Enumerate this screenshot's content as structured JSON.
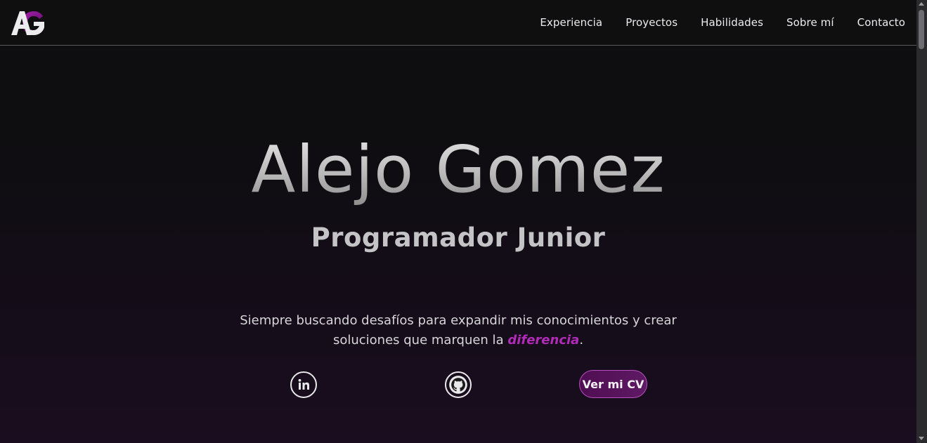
{
  "header": {
    "logo_icon": "ag-monogram-logo",
    "nav": [
      {
        "label": "Experiencia"
      },
      {
        "label": "Proyectos"
      },
      {
        "label": "Habilidades"
      },
      {
        "label": "Sobre mí"
      },
      {
        "label": "Contacto"
      }
    ]
  },
  "hero": {
    "name": "Alejo Gomez",
    "role": "Programador Junior",
    "description_before": "Siempre buscando desafíos para expandir mis conocimientos y crear soluciones que marquen la ",
    "description_highlight": "diferencia",
    "description_after": ".",
    "social": [
      {
        "icon": "linkedin-icon"
      },
      {
        "icon": "github-icon"
      }
    ],
    "cv_button": "Ver mi CV"
  },
  "colors": {
    "accent": "#b12ab8",
    "background": "#0e0e10",
    "text": "#ececef"
  }
}
